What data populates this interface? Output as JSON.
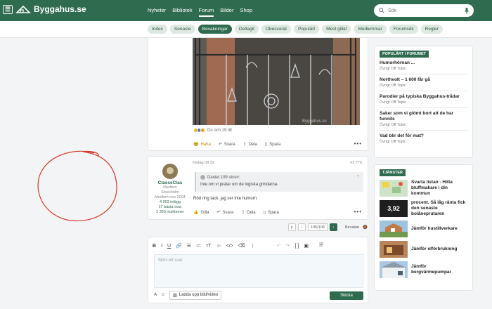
{
  "brand": {
    "name": "Byggahus.se"
  },
  "nav": {
    "items": [
      "Nyheter",
      "Bibliotek",
      "Forum",
      "Bilder",
      "Shop"
    ],
    "active": "Forum"
  },
  "search": {
    "placeholder": "Sök"
  },
  "subnav": {
    "items": [
      "Index",
      "Senaste",
      "Bevakningar",
      "Deltagit",
      "Obesvarat",
      "Populärt",
      "Mest gillat",
      "Medlemmar",
      "Forumsök",
      "Regler"
    ],
    "active": "Bevakningar"
  },
  "post1": {
    "reaction_summary": "Du och 19 till",
    "actions": {
      "react": "Haha",
      "reply": "Svara",
      "share": "Dela",
      "save": "Spara"
    }
  },
  "post2": {
    "author": {
      "name": "ClasseClas",
      "role": "Medlem",
      "location": "Stockholm",
      "since": "Medlem nov 2004",
      "posts": "4 003 inlägg",
      "best": "17 bästa svar",
      "reactions": "2 363 reaktioner"
    },
    "date": "fredag 09:32",
    "number": "#2 775",
    "quote": {
      "author": "Daniel 109 skrev:",
      "text": "Inte om vi pratar om de logiska grindarna."
    },
    "text": "Röd ring tack, jag ser inte humorn.",
    "actions": {
      "react": "Gilla",
      "reply": "Svara",
      "share": "Dela",
      "save": "Spara"
    }
  },
  "pager": {
    "current": "105/106",
    "bevaka": "Bevakar"
  },
  "editor": {
    "placeholder": "Skriv ett svar",
    "upload": "Ladda upp bild/video",
    "send": "Skicka"
  },
  "popular": {
    "title": "POPULÄRT I FORUMET",
    "items": [
      {
        "title": "Humorhörnan ...",
        "forum": "Övrigt Off Topic"
      },
      {
        "title": "Northvolt – 1 600 får gå",
        "forum": "Övrigt Off Topic"
      },
      {
        "title": "Parodier på typiska Byggahus-trådar",
        "forum": "Övrigt Off Topic"
      },
      {
        "title": "Saker som vi glömt bort att de har funnits",
        "forum": "Övrigt Off Topic"
      },
      {
        "title": "Vad blir det för mat?",
        "forum": "Övrigt Off Topic"
      }
    ]
  },
  "services": {
    "title": "TJÄNSTER",
    "items": [
      {
        "title": "Svarta listan - Hitta bluffmakare i din kommun"
      },
      {
        "title": "procent. Så låg ränta fick den senaste bolåneprutaren",
        "badge": "3,92"
      },
      {
        "title": "Jämför hustillverkare"
      },
      {
        "title": "Jämför elförbrukning"
      },
      {
        "title": "Jämför bergvärmepumpar"
      }
    ]
  },
  "colors": {
    "brand": "#2f6b4f",
    "annotation": "#d33a2c"
  }
}
